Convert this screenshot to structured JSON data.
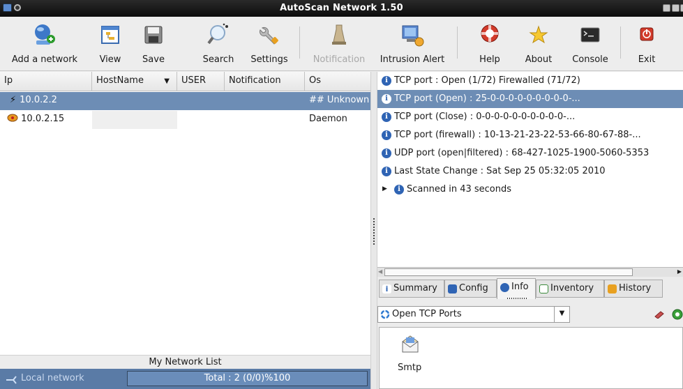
{
  "window": {
    "title": "AutoScan Network 1.50"
  },
  "toolbar": {
    "buttons": [
      {
        "label": "Add a network",
        "icon": "add-network-icon",
        "enabled": true
      },
      {
        "label": "View",
        "icon": "view-icon",
        "enabled": true
      },
      {
        "label": "Save",
        "icon": "save-icon",
        "enabled": true
      },
      {
        "label": "Search",
        "icon": "search-icon",
        "enabled": true
      },
      {
        "label": "Settings",
        "icon": "settings-icon",
        "enabled": true
      },
      {
        "label": "Notification",
        "icon": "notification-icon",
        "enabled": false
      },
      {
        "label": "Intrusion Alert",
        "icon": "intrusion-alert-icon",
        "enabled": true
      },
      {
        "label": "Help",
        "icon": "help-icon",
        "enabled": true
      },
      {
        "label": "About",
        "icon": "about-icon",
        "enabled": true
      },
      {
        "label": "Console",
        "icon": "console-icon",
        "enabled": true
      },
      {
        "label": "Exit",
        "icon": "exit-icon",
        "enabled": true
      }
    ]
  },
  "hosts": {
    "columns": [
      "Ip",
      "HostName",
      "USER",
      "Notification",
      "Os"
    ],
    "rows": [
      {
        "ip": "10.0.2.2",
        "hostname": "",
        "user": "",
        "notification": "",
        "os": "## Unknown",
        "selected": true
      },
      {
        "ip": "10.0.2.15",
        "hostname": "",
        "user": "",
        "notification": "",
        "os": "Daemon",
        "selected": false
      }
    ],
    "list_title": "My Network List",
    "status": {
      "network": "Local network",
      "total": "Total : 2  (0/0)%100"
    }
  },
  "details": {
    "items": [
      "TCP port : Open (1/72) Firewalled (71/72)",
      "TCP port (Open) : 25-0-0-0-0-0-0-0-0-0-...",
      "TCP port (Close) : 0-0-0-0-0-0-0-0-0-0-...",
      "TCP port (firewall) : 10-13-21-23-22-53-66-80-67-88-...",
      "UDP port (open|filtered) : 68-427-1025-1900-5060-5353",
      "Last State Change : Sat Sep 25 05:32:05 2010",
      "Scanned in 43 seconds"
    ],
    "selected_index": 1
  },
  "tabs": [
    "Summary",
    "Config",
    "Info",
    "Inventory",
    "History"
  ],
  "active_tab": "Info",
  "ports_combo": {
    "value": "Open TCP Ports"
  },
  "ports": [
    {
      "label": "Smtp",
      "icon": "mail-icon"
    }
  ],
  "colors": {
    "selection": "#6d8db5",
    "status_bar": "#5a7ba6",
    "title_bar": "#111111"
  }
}
